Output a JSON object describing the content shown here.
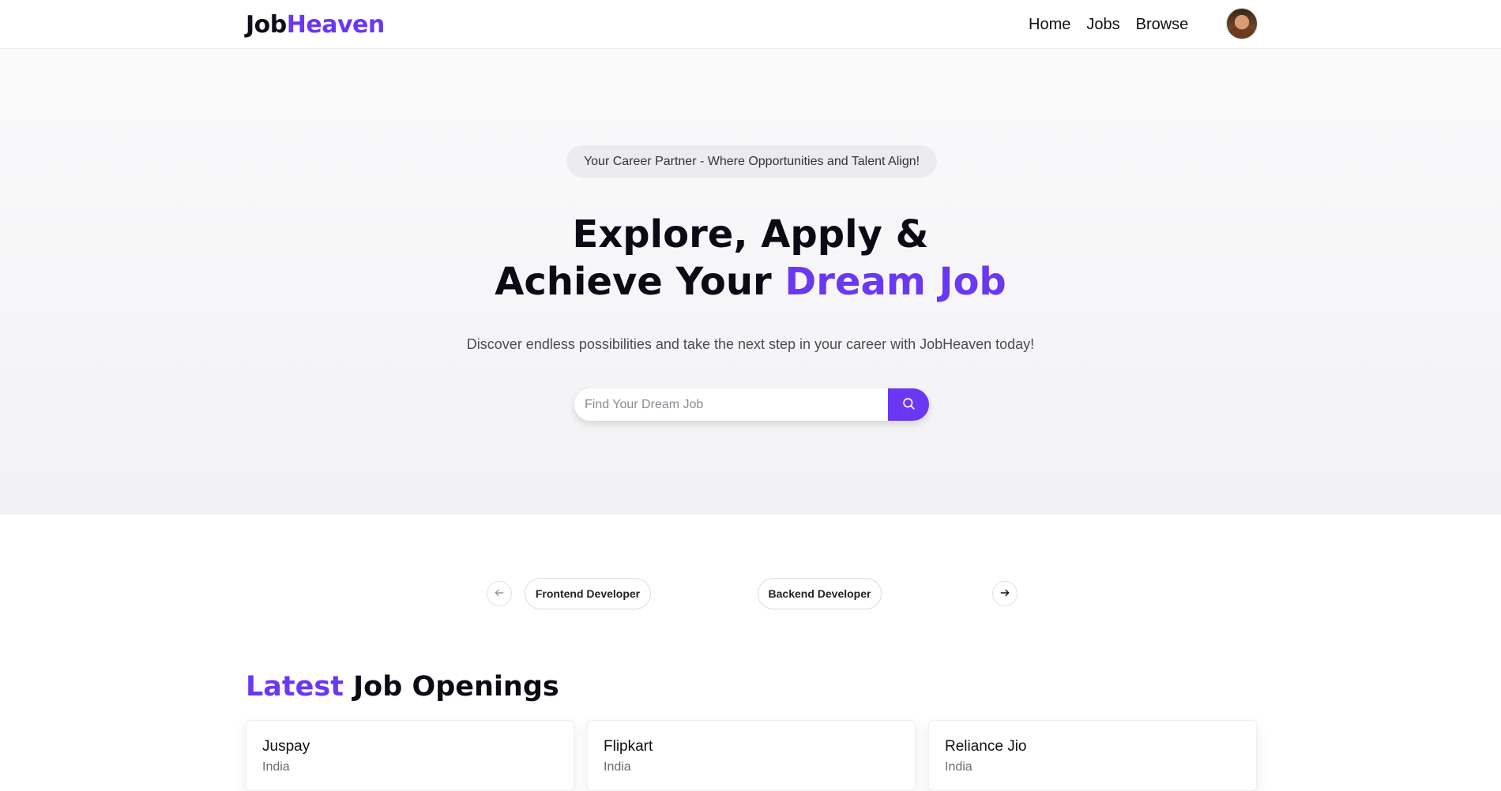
{
  "brand": {
    "logo_part1": "Job",
    "logo_part2": "Heaven",
    "accent_color": "#6a38f2"
  },
  "nav": {
    "links": [
      {
        "label": "Home"
      },
      {
        "label": "Jobs"
      },
      {
        "label": "Browse"
      }
    ]
  },
  "hero": {
    "badge": "Your Career Partner - Where Opportunities and Talent Align!",
    "title_line1": "Explore, Apply &",
    "title_line2_plain": "Achieve Your ",
    "title_line2_accent": "Dream Job",
    "subtitle": "Discover endless possibilities and take the next step in your career with JobHeaven today!",
    "search": {
      "placeholder": "Find Your Dream Job",
      "value": ""
    }
  },
  "carousel": {
    "categories": [
      {
        "label": "Frontend Developer"
      },
      {
        "label": "Backend Developer"
      }
    ]
  },
  "latest_jobs": {
    "title_accent": "Latest",
    "title_plain": " Job Openings",
    "cards": [
      {
        "company": "Juspay",
        "location": "India"
      },
      {
        "company": "Flipkart",
        "location": "India"
      },
      {
        "company": "Reliance Jio",
        "location": "India"
      }
    ]
  },
  "icons": {
    "search": "search-icon",
    "prev": "arrow-left-icon",
    "next": "arrow-right-icon"
  }
}
